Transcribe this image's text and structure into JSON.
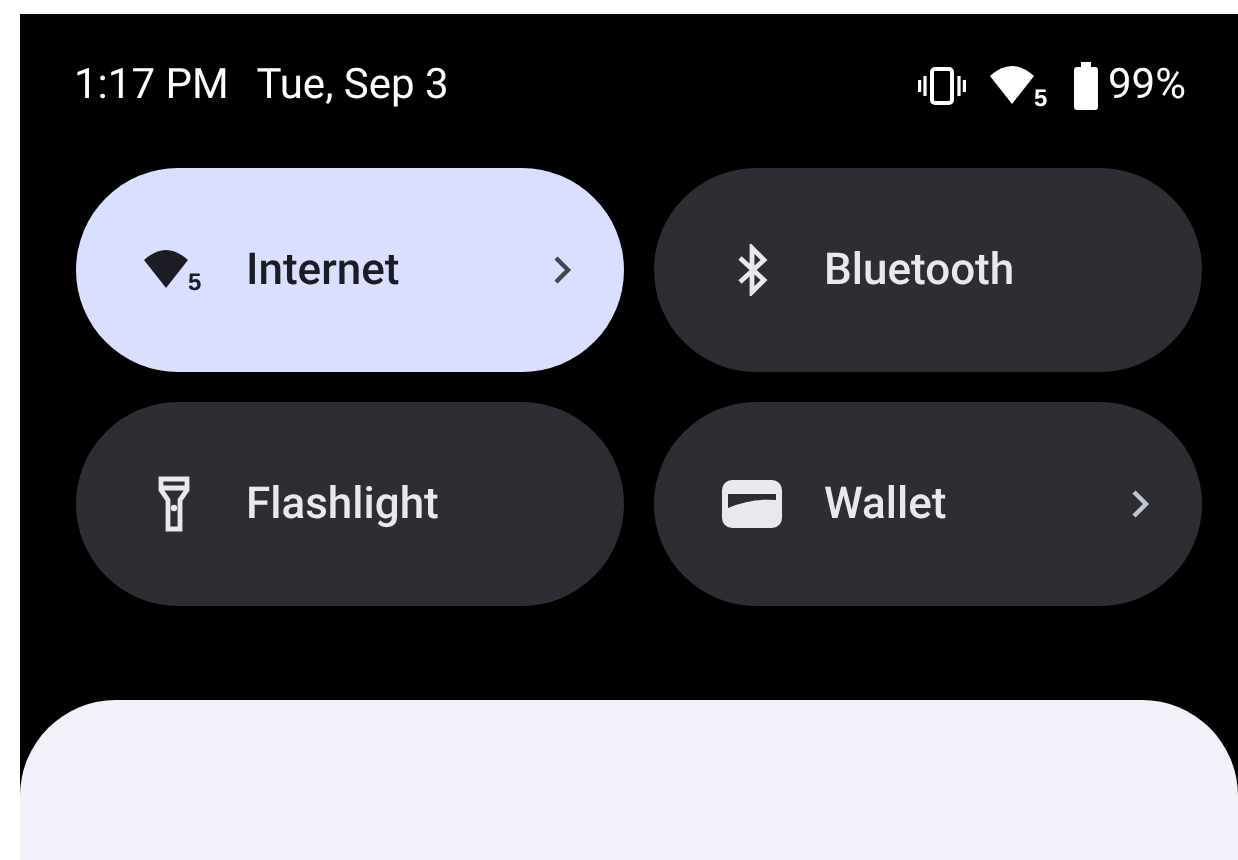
{
  "status_bar": {
    "time": "1:17 PM",
    "date": "Tue, Sep 3",
    "wifi_badge": "5",
    "battery": "99%"
  },
  "tiles": [
    {
      "kind": "internet",
      "label": "Internet",
      "on": true,
      "chevron": true,
      "wifi_badge": "5"
    },
    {
      "kind": "bluetooth",
      "label": "Bluetooth",
      "on": false,
      "chevron": false
    },
    {
      "kind": "flashlight",
      "label": "Flashlight",
      "on": false,
      "chevron": false
    },
    {
      "kind": "wallet",
      "label": "Wallet",
      "on": false,
      "chevron": true
    }
  ]
}
